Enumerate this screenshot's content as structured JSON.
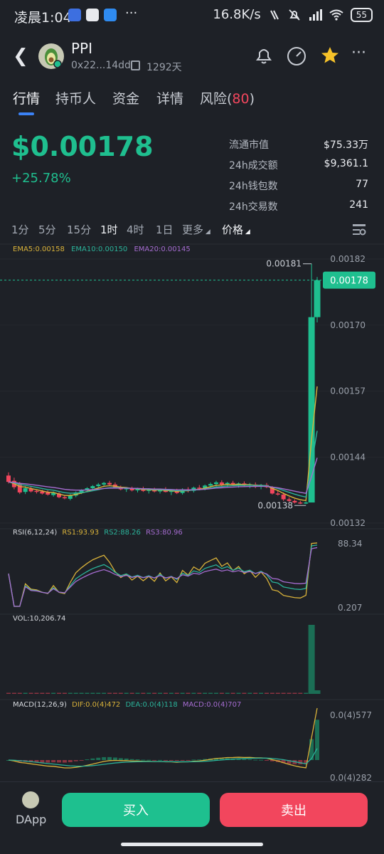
{
  "status": {
    "time": "凌晨1:04",
    "net": "16.8K/s",
    "battery": "55"
  },
  "header": {
    "title": "PPI",
    "address": "0x22...14dd",
    "days": "1292天"
  },
  "tabs": [
    {
      "label": "行情"
    },
    {
      "label": "持币人"
    },
    {
      "label": "资金"
    },
    {
      "label": "详情"
    },
    {
      "label": "风险(",
      "badge": "80",
      "suffix": ")"
    }
  ],
  "price": {
    "value": "$0.00178",
    "change": "+25.78%"
  },
  "stats": [
    {
      "label": "流通市值",
      "value": "$75.33万"
    },
    {
      "label": "24h成交额",
      "value": "$9,361.1"
    },
    {
      "label": "24h钱包数",
      "value": "77"
    },
    {
      "label": "24h交易数",
      "value": "241"
    }
  ],
  "intervals": [
    "1分",
    "5分",
    "15分",
    "1时",
    "4时",
    "1日",
    "更多",
    "价格"
  ],
  "active_interval": "1时",
  "indicators": {
    "ema": [
      "EMA5:0.00158",
      "EMA10:0.00150",
      "EMA20:0.00145"
    ],
    "rsi_title": "RSI(6,12,24)",
    "rsi": [
      "RS1:93.93",
      "RS2:88.26",
      "RS3:80.96"
    ],
    "vol": "VOL:10,206.74",
    "macd_title": "MACD(12,26,9)",
    "macd": [
      "DIF:0.0(4)472",
      "DEA:0.0(4)118",
      "MACD:0.0(4)707"
    ]
  },
  "colors": {
    "up": "#1fbf8f",
    "down": "#f2465d",
    "ema5": "#d9b23a",
    "ema10": "#2bb39a",
    "ema20": "#a56cd0",
    "background": "#1e2127"
  },
  "chart_data": {
    "type": "candlestick",
    "y_axis_labels": [
      "0.00182",
      "0.00170",
      "0.00157",
      "0.00144",
      "0.00132"
    ],
    "current_price_label": "0.00178",
    "high_label": "0.00181",
    "low_label": "0.00138",
    "ylim": [
      0.00132,
      0.00182
    ],
    "rsi_axis_labels": [
      "88.34",
      "0.207"
    ],
    "macd_axis_labels": [
      "0.0(4)577",
      "0.0(4)282"
    ],
    "candles": [
      {
        "o": 0.00141,
        "h": 0.001416,
        "l": 0.001395,
        "c": 0.001398
      },
      {
        "o": 0.0014,
        "h": 0.001406,
        "l": 0.001384,
        "c": 0.001388
      },
      {
        "o": 0.001395,
        "h": 0.001398,
        "l": 0.001375,
        "c": 0.001378
      },
      {
        "o": 0.001379,
        "h": 0.00139,
        "l": 0.001375,
        "c": 0.001386
      },
      {
        "o": 0.001385,
        "h": 0.001389,
        "l": 0.001378,
        "c": 0.00138
      },
      {
        "o": 0.001381,
        "h": 0.001384,
        "l": 0.001376,
        "c": 0.001379
      },
      {
        "o": 0.00138,
        "h": 0.001383,
        "l": 0.001374,
        "c": 0.001376
      },
      {
        "o": 0.001378,
        "h": 0.001382,
        "l": 0.001372,
        "c": 0.001374
      },
      {
        "o": 0.001373,
        "h": 0.00138,
        "l": 0.00137,
        "c": 0.001377
      },
      {
        "o": 0.001376,
        "h": 0.001379,
        "l": 0.001367,
        "c": 0.001369
      },
      {
        "o": 0.001369,
        "h": 0.001372,
        "l": 0.001365,
        "c": 0.001367
      },
      {
        "o": 0.001366,
        "h": 0.001375,
        "l": 0.001363,
        "c": 0.001372
      },
      {
        "o": 0.001372,
        "h": 0.00138,
        "l": 0.001369,
        "c": 0.001378
      },
      {
        "o": 0.001378,
        "h": 0.001384,
        "l": 0.001375,
        "c": 0.001382
      },
      {
        "o": 0.001382,
        "h": 0.001388,
        "l": 0.001379,
        "c": 0.001386
      },
      {
        "o": 0.001386,
        "h": 0.001392,
        "l": 0.001383,
        "c": 0.00139
      },
      {
        "o": 0.00139,
        "h": 0.001396,
        "l": 0.001387,
        "c": 0.001393
      },
      {
        "o": 0.001393,
        "h": 0.001398,
        "l": 0.001389,
        "c": 0.001396
      },
      {
        "o": 0.001396,
        "h": 0.0014,
        "l": 0.001391,
        "c": 0.001393
      },
      {
        "o": 0.001393,
        "h": 0.001397,
        "l": 0.001386,
        "c": 0.001388
      },
      {
        "o": 0.001388,
        "h": 0.001391,
        "l": 0.001382,
        "c": 0.001384
      },
      {
        "o": 0.001384,
        "h": 0.001388,
        "l": 0.001379,
        "c": 0.001386
      },
      {
        "o": 0.001386,
        "h": 0.001389,
        "l": 0.00138,
        "c": 0.001382
      },
      {
        "o": 0.001382,
        "h": 0.001387,
        "l": 0.001378,
        "c": 0.001384
      },
      {
        "o": 0.001384,
        "h": 0.001389,
        "l": 0.001379,
        "c": 0.001381
      },
      {
        "o": 0.001381,
        "h": 0.001386,
        "l": 0.001376,
        "c": 0.001383
      },
      {
        "o": 0.001383,
        "h": 0.001387,
        "l": 0.001378,
        "c": 0.00138
      },
      {
        "o": 0.00138,
        "h": 0.001385,
        "l": 0.001376,
        "c": 0.001384
      },
      {
        "o": 0.001384,
        "h": 0.001388,
        "l": 0.001378,
        "c": 0.001379
      },
      {
        "o": 0.001379,
        "h": 0.001384,
        "l": 0.001373,
        "c": 0.001381
      },
      {
        "o": 0.001381,
        "h": 0.001385,
        "l": 0.001375,
        "c": 0.001377
      },
      {
        "o": 0.001377,
        "h": 0.001386,
        "l": 0.001374,
        "c": 0.001384
      },
      {
        "o": 0.001384,
        "h": 0.001388,
        "l": 0.001378,
        "c": 0.001381
      },
      {
        "o": 0.001381,
        "h": 0.001389,
        "l": 0.001378,
        "c": 0.001387
      },
      {
        "o": 0.001387,
        "h": 0.001392,
        "l": 0.001382,
        "c": 0.001385
      },
      {
        "o": 0.001385,
        "h": 0.001393,
        "l": 0.001382,
        "c": 0.001391
      },
      {
        "o": 0.001391,
        "h": 0.001397,
        "l": 0.001387,
        "c": 0.001394
      },
      {
        "o": 0.001394,
        "h": 0.0014,
        "l": 0.001389,
        "c": 0.001397
      },
      {
        "o": 0.001397,
        "h": 0.001401,
        "l": 0.00139,
        "c": 0.001393
      },
      {
        "o": 0.001393,
        "h": 0.001398,
        "l": 0.001387,
        "c": 0.001396
      },
      {
        "o": 0.001396,
        "h": 0.0014,
        "l": 0.00139,
        "c": 0.001392
      },
      {
        "o": 0.001392,
        "h": 0.001397,
        "l": 0.001387,
        "c": 0.001395
      },
      {
        "o": 0.001395,
        "h": 0.001399,
        "l": 0.001389,
        "c": 0.001391
      },
      {
        "o": 0.001391,
        "h": 0.001396,
        "l": 0.001386,
        "c": 0.001393
      },
      {
        "o": 0.001393,
        "h": 0.001397,
        "l": 0.001386,
        "c": 0.001389
      },
      {
        "o": 0.001389,
        "h": 0.001394,
        "l": 0.001384,
        "c": 0.001392
      },
      {
        "o": 0.001392,
        "h": 0.001396,
        "l": 0.001386,
        "c": 0.001388
      },
      {
        "o": 0.001388,
        "h": 0.00139,
        "l": 0.001374,
        "c": 0.001376
      },
      {
        "o": 0.001376,
        "h": 0.001382,
        "l": 0.001372,
        "c": 0.001374
      },
      {
        "o": 0.001374,
        "h": 0.001378,
        "l": 0.001362,
        "c": 0.001365
      },
      {
        "o": 0.001365,
        "h": 0.001369,
        "l": 0.00136,
        "c": 0.001362
      },
      {
        "o": 0.001362,
        "h": 0.001365,
        "l": 0.001357,
        "c": 0.001359
      },
      {
        "o": 0.001359,
        "h": 0.001362,
        "l": 0.001356,
        "c": 0.001358
      },
      {
        "o": 0.001358,
        "h": 0.001361,
        "l": 0.001356,
        "c": 0.001359
      },
      {
        "o": 0.001359,
        "h": 0.001811,
        "l": 0.00138,
        "c": 0.00171
      },
      {
        "o": 0.00171,
        "h": 0.001786,
        "l": 0.0017,
        "c": 0.00178
      }
    ]
  }
}
